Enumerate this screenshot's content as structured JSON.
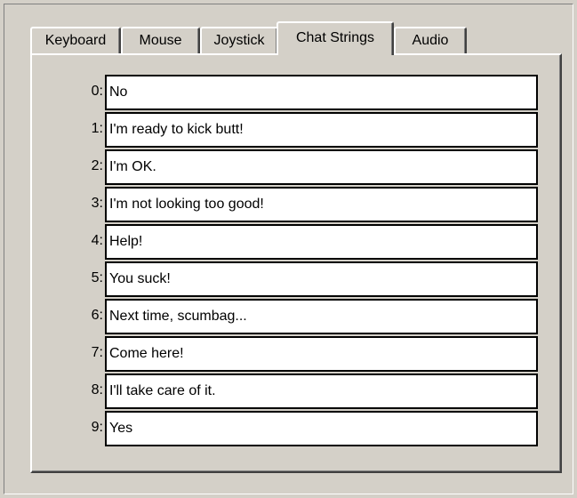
{
  "tabs": [
    {
      "label": "Keyboard"
    },
    {
      "label": "Mouse"
    },
    {
      "label": "Joystick"
    },
    {
      "label": "Chat Strings"
    },
    {
      "label": "Audio"
    }
  ],
  "active_tab": "Chat Strings",
  "chat_strings": [
    {
      "index_label": "0:",
      "value": "No"
    },
    {
      "index_label": "1:",
      "value": "I'm ready to kick butt!"
    },
    {
      "index_label": "2:",
      "value": "I'm OK."
    },
    {
      "index_label": "3:",
      "value": "I'm not looking too good!"
    },
    {
      "index_label": "4:",
      "value": "Help!"
    },
    {
      "index_label": "5:",
      "value": "You suck!"
    },
    {
      "index_label": "6:",
      "value": "Next time, scumbag..."
    },
    {
      "index_label": "7:",
      "value": "Come here!"
    },
    {
      "index_label": "8:",
      "value": "I'll take care of it."
    },
    {
      "index_label": "9:",
      "value": "Yes"
    }
  ]
}
